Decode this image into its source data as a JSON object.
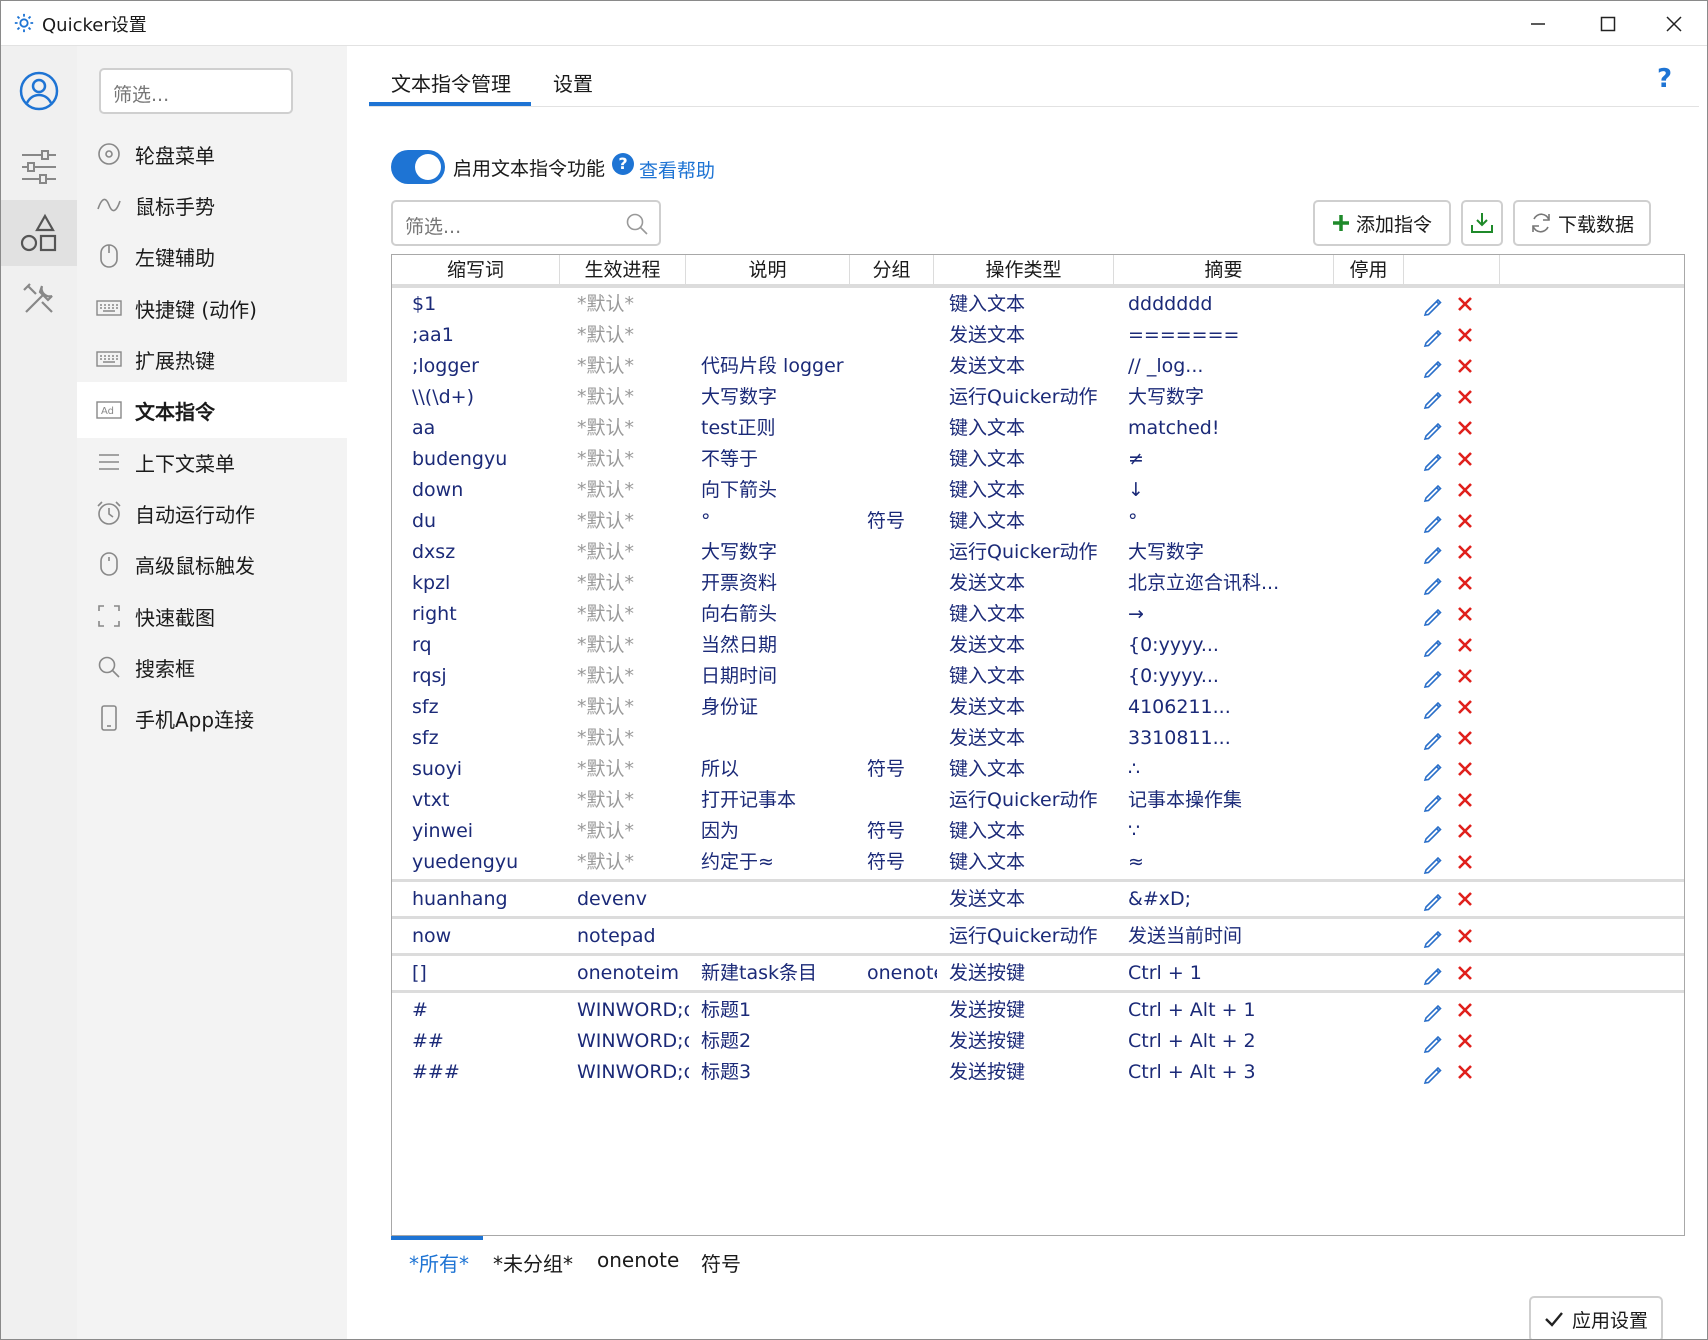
{
  "window": {
    "title": "Quicker设置"
  },
  "sidebar": {
    "filter_placeholder": "筛选...",
    "items": [
      {
        "label": "轮盘菜单",
        "icon": "wheel-icon"
      },
      {
        "label": "鼠标手势",
        "icon": "gesture-icon"
      },
      {
        "label": "左键辅助",
        "icon": "mouse-icon"
      },
      {
        "label": "快捷键 (动作)",
        "icon": "keyboard-icon"
      },
      {
        "label": "扩展热键",
        "icon": "keyboard-icon"
      },
      {
        "label": "文本指令",
        "icon": "ad-icon",
        "selected": true
      },
      {
        "label": "上下文菜单",
        "icon": "menu-icon"
      },
      {
        "label": "自动运行动作",
        "icon": "alarm-icon"
      },
      {
        "label": "高级鼠标触发",
        "icon": "mouse-icon"
      },
      {
        "label": "快速截图",
        "icon": "screenshot-icon"
      },
      {
        "label": "搜索框",
        "icon": "search-icon"
      },
      {
        "label": "手机App连接",
        "icon": "phone-icon"
      }
    ]
  },
  "tabs": [
    {
      "label": "文本指令管理",
      "active": true
    },
    {
      "label": "设置"
    }
  ],
  "help_symbol": "?",
  "toggle": {
    "label": "启用文本指令功能",
    "on": true
  },
  "help_link": "查看帮助",
  "filter_placeholder": "筛选...",
  "buttons": {
    "add": "添加指令",
    "download": "下载数据",
    "apply": "应用设置"
  },
  "table": {
    "columns": [
      "缩写词",
      "生效进程",
      "说明",
      "分组",
      "操作类型",
      "摘要",
      "停用"
    ],
    "rows": [
      {
        "abbr": "$1",
        "process": "*默认*",
        "desc": "",
        "group": "",
        "type": "键入文本",
        "summary": "ddddddd"
      },
      {
        "abbr": ";aa1",
        "process": "*默认*",
        "desc": "",
        "group": "",
        "type": "发送文本",
        "summary": "======="
      },
      {
        "abbr": ";logger",
        "process": "*默认*",
        "desc": "代码片段 logger",
        "group": "",
        "type": "发送文本",
        "summary": "// _log..."
      },
      {
        "abbr": "\\\\(\\d+)",
        "process": "*默认*",
        "desc": "大写数字",
        "group": "",
        "type": "运行Quicker动作",
        "summary": "大写数字"
      },
      {
        "abbr": "aa",
        "process": "*默认*",
        "desc": "test正则",
        "group": "",
        "type": "键入文本",
        "summary": "matched!"
      },
      {
        "abbr": "budengyu",
        "process": "*默认*",
        "desc": "不等于",
        "group": "",
        "type": "键入文本",
        "summary": "≠"
      },
      {
        "abbr": "down",
        "process": "*默认*",
        "desc": "向下箭头",
        "group": "",
        "type": "键入文本",
        "summary": "↓"
      },
      {
        "abbr": "du",
        "process": "*默认*",
        "desc": "°",
        "group": "符号",
        "type": "键入文本",
        "summary": "°"
      },
      {
        "abbr": "dxsz",
        "process": "*默认*",
        "desc": "大写数字",
        "group": "",
        "type": "运行Quicker动作",
        "summary": "大写数字"
      },
      {
        "abbr": "kpzl",
        "process": "*默认*",
        "desc": "开票资料",
        "group": "",
        "type": "发送文本",
        "summary": "北京立迩合讯科..."
      },
      {
        "abbr": "right",
        "process": "*默认*",
        "desc": "向右箭头",
        "group": "",
        "type": "键入文本",
        "summary": "→"
      },
      {
        "abbr": "rq",
        "process": "*默认*",
        "desc": "当然日期",
        "group": "",
        "type": "发送文本",
        "summary": "{0:yyyy..."
      },
      {
        "abbr": "rqsj",
        "process": "*默认*",
        "desc": "日期时间",
        "group": "",
        "type": "键入文本",
        "summary": "{0:yyyy..."
      },
      {
        "abbr": "sfz",
        "process": "*默认*",
        "desc": "身份证",
        "group": "",
        "type": "发送文本",
        "summary": "4106211..."
      },
      {
        "abbr": "sfz",
        "process": "*默认*",
        "desc": "",
        "group": "",
        "type": "发送文本",
        "summary": "3310811..."
      },
      {
        "abbr": "suoyi",
        "process": "*默认*",
        "desc": "所以",
        "group": "符号",
        "type": "键入文本",
        "summary": "∴"
      },
      {
        "abbr": "vtxt",
        "process": "*默认*",
        "desc": "打开记事本",
        "group": "",
        "type": "运行Quicker动作",
        "summary": "记事本操作集"
      },
      {
        "abbr": "yinwei",
        "process": "*默认*",
        "desc": "因为",
        "group": "符号",
        "type": "键入文本",
        "summary": "∵"
      },
      {
        "abbr": "yuedengyu",
        "process": "*默认*",
        "desc": "约定于≈",
        "group": "符号",
        "type": "键入文本",
        "summary": "≈"
      },
      {
        "abbr": "huanhang",
        "process": "devenv",
        "desc": "",
        "group": "",
        "type": "发送文本",
        "summary": "&#xD;"
      },
      {
        "abbr": "now",
        "process": "notepad",
        "desc": "",
        "group": "",
        "type": "运行Quicker动作",
        "summary": "发送当前时间"
      },
      {
        "abbr": "[]",
        "process": "onenoteim",
        "desc": "新建task条目",
        "group": "onenote",
        "type": "发送按键",
        "summary": "Ctrl + 1"
      },
      {
        "abbr": "#",
        "process": "WINWORD;or",
        "desc": "标题1",
        "group": "",
        "type": "发送按键",
        "summary": "Ctrl + Alt + 1"
      },
      {
        "abbr": "##",
        "process": "WINWORD;or",
        "desc": "标题2",
        "group": "",
        "type": "发送按键",
        "summary": "Ctrl + Alt + 2"
      },
      {
        "abbr": "###",
        "process": "WINWORD;or",
        "desc": "标题3",
        "group": "",
        "type": "发送按键",
        "summary": "Ctrl + Alt + 3"
      }
    ]
  },
  "group_tabs": [
    {
      "label": "*所有*",
      "active": true
    },
    {
      "label": "*未分组*"
    },
    {
      "label": "onenote"
    },
    {
      "label": "符号"
    }
  ],
  "colors": {
    "accent": "#1e74d4",
    "cell_text": "#1b2a78",
    "delete": "#e0201c",
    "add_green": "#1f8a2a"
  }
}
